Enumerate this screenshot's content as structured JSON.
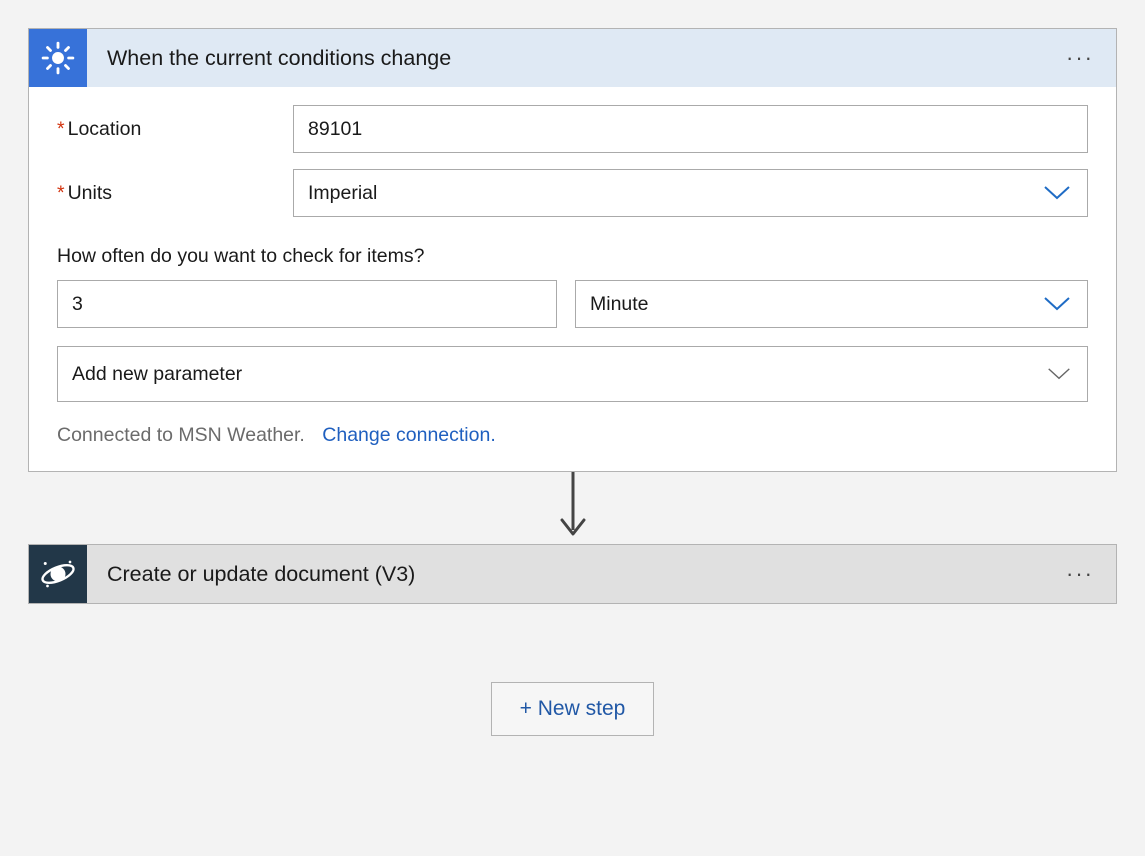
{
  "trigger": {
    "title": "When the current conditions change",
    "icon": "sun-icon",
    "fields": {
      "location": {
        "label": "Location",
        "value": "89101",
        "required": true
      },
      "units": {
        "label": "Units",
        "value": "Imperial",
        "required": true
      }
    },
    "polling": {
      "label": "How often do you want to check for items?",
      "interval": "3",
      "frequency": "Minute"
    },
    "paramDropdown": {
      "label": "Add new parameter"
    },
    "connection": {
      "text": "Connected to MSN Weather.",
      "link": "Change connection."
    }
  },
  "action": {
    "title": "Create or update document (V3)",
    "icon": "cosmos-icon"
  },
  "newStep": {
    "label": "+ New step"
  }
}
